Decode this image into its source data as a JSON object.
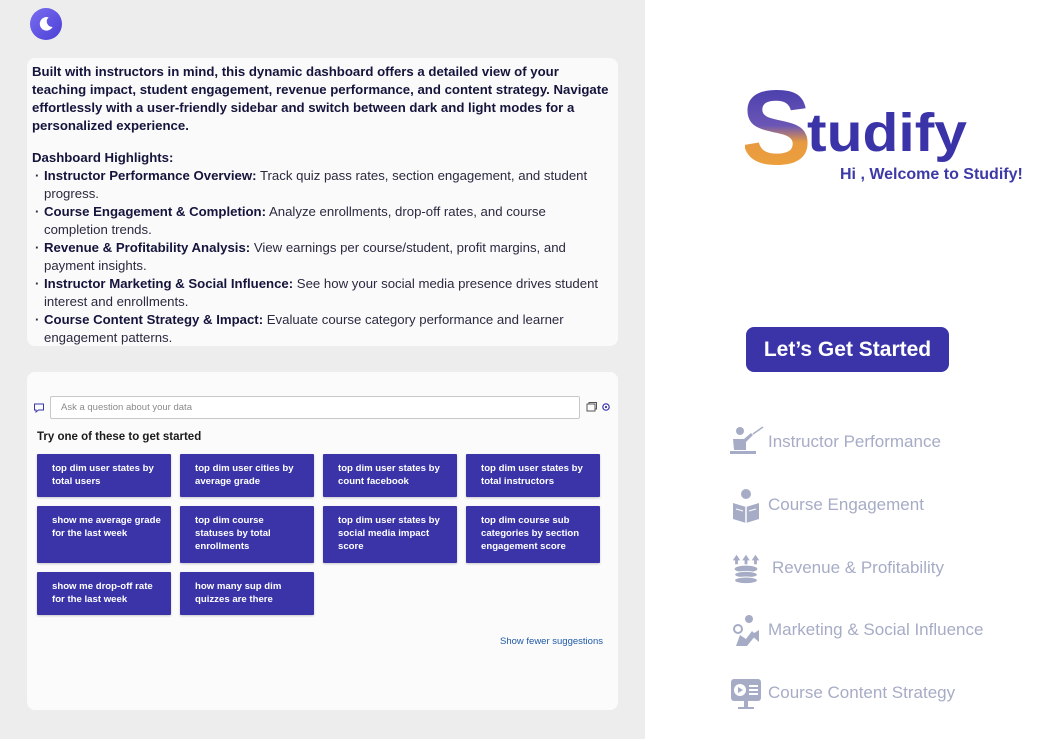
{
  "description": {
    "intro": "Built with instructors in mind, this dynamic dashboard offers a detailed view of your teaching impact, student engagement, revenue performance, and content strategy. Navigate effortlessly with a user-friendly sidebar and switch between dark and light modes for a personalized experience.",
    "highlights_title": "Dashboard Highlights:",
    "highlights": [
      {
        "title": "Instructor Performance Overview:",
        "text": " Track quiz pass rates, section engagement, and student progress."
      },
      {
        "title": "Course  Engagement & Completion:",
        "text": " Analyze enrollments, drop-off rates, and course completion trends."
      },
      {
        "title": "Revenue & Profitability Analysis:",
        "text": " View earnings per course/student, profit margins, and payment insights."
      },
      {
        "title": "Instructor  Marketing & Social Influence:",
        "text": " See how your social media presence drives student interest and enrollments."
      },
      {
        "title": "Course Content Strategy & Impact:",
        "text": " Evaluate course category performance and learner engagement patterns."
      }
    ]
  },
  "qa": {
    "placeholder": "Ask a question about your data",
    "try_label": "Try one of these to get started",
    "suggestions": [
      "top dim user states by total users",
      "top dim user cities by average grade",
      "top dim user states by count facebook",
      "top dim user states by total instructors",
      "show me average grade for the last week",
      "top dim course statuses by total enrollments",
      "top dim user states by social media impact score",
      "top dim course sub categories by section engagement score",
      "show me drop-off rate for the last week",
      "how many sup dim quizzes are there"
    ],
    "show_fewer": "Show fewer suggestions"
  },
  "brand": {
    "logo_s": "S",
    "logo_rest": "tudify",
    "welcome": "Hi , Welcome to Studify!",
    "accent": "#3a34a8"
  },
  "cta": {
    "label": "Let’s Get Started"
  },
  "nav": [
    {
      "label": "Instructor Performance",
      "icon": "instructor-icon"
    },
    {
      "label": "Course Engagement",
      "icon": "reading-icon"
    },
    {
      "label": "Revenue & Profitability",
      "icon": "coins-icon"
    },
    {
      "label": "Marketing & Social Influence",
      "icon": "marketing-icon"
    },
    {
      "label": "Course Content Strategy",
      "icon": "video-content-icon"
    }
  ]
}
